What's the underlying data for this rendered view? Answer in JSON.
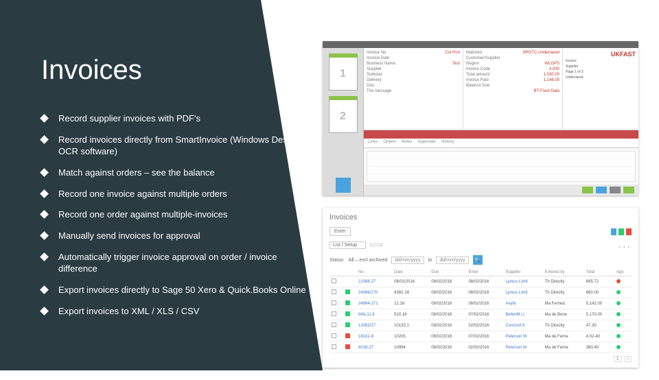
{
  "title": "Invoices",
  "bullets": [
    "Record supplier invoices with PDF's",
    "Record invoices directly from SmartInvoice (Windows Desktop OCR software)",
    "Match against orders – see the balance",
    "Record one invoice against multiple orders",
    "Record one order against multiple-invoices",
    "Manually send invoices for approval",
    "Automatically trigger invoice approval on order / invoice difference",
    "Export invoices directly to Sage 50 Xero & Quick.Books Online",
    "Export invoices to XML / XLS / CSV"
  ],
  "app_shot": {
    "thumbs": [
      "1",
      "2"
    ],
    "logo": "UKFAST",
    "header_form": {
      "col1": [
        {
          "lab": "Invoice No",
          "val": "Col Port"
        },
        {
          "lab": "Invoice Date",
          "val": ""
        },
        {
          "lab": "Business Name",
          "val": "Test"
        },
        {
          "lab": "Supplier",
          "val": ""
        },
        {
          "lab": "Subtotal",
          "val": ""
        },
        {
          "lab": "Delivery",
          "val": ""
        },
        {
          "lab": "Disc",
          "val": ""
        },
        {
          "lab": "The message",
          "val": ""
        }
      ],
      "col2": [
        {
          "lab": "Matched",
          "val": "BRSTC-Undeclared"
        },
        {
          "lab": "Customer/Supplier",
          "val": ""
        },
        {
          "lab": "Region",
          "val": "WLGPS"
        },
        {
          "lab": "Invoice Code",
          "val": "4,930"
        },
        {
          "lab": "Total amount",
          "val": "1,030.00"
        },
        {
          "lab": "Invoice Paid",
          "val": "1,148.00"
        },
        {
          "lab": "Balance Due",
          "val": ""
        },
        {
          "lab": "",
          "val": "BT-Food Data"
        }
      ]
    },
    "side_lines": [
      "Invoice",
      "Supplier",
      "Page 1 of 3",
      "Undeclared"
    ],
    "tabs": [
      "Lines",
      "Orders",
      "Notes",
      "Approvals",
      "History"
    ]
  },
  "web_shot": {
    "title": "Invoices",
    "btn": "Enter",
    "filter_label": "List / Setup",
    "status_prefix": "Status:",
    "status_all": "All – excl archived",
    "to": "to",
    "headers": [
      "",
      "",
      "No",
      "Date",
      "Due",
      "Enter",
      "Supplier",
      "Entered by",
      "Total",
      "App"
    ],
    "rows": [
      {
        "sq": "",
        "no": "21088-27",
        "date": "08/02/2016",
        "due": "08/02/2016",
        "enter": "08/02/2016",
        "supplier": "Lyreco Limit",
        "by": "Th Directly",
        "total": "665.72",
        "app": "red"
      },
      {
        "sq": "green",
        "no": "24086/270",
        "date": "6382-16",
        "due": "08/02/2016",
        "enter": "08/02/2016",
        "supplier": "Lyreco Limit",
        "by": "Th Directly",
        "total": "680.00",
        "app": "green"
      },
      {
        "sq": "green",
        "no": "24994-271",
        "date": "12.16",
        "due": "08/02/2016",
        "enter": "08/02/2016",
        "supplier": "Avylis",
        "by": "Ma Ferned",
        "total": "5,142.00",
        "app": "green"
      },
      {
        "sq": "green",
        "no": "MAL11.8",
        "date": "510.18",
        "due": "08/02/2016",
        "enter": "07/02/2016",
        "supplier": "BetterM Li",
        "by": "Ma de Bone",
        "total": "5,170.00",
        "app": "green"
      },
      {
        "sq": "green",
        "no": "12082/27",
        "date": "10133.1",
        "due": "08/02/2016",
        "enter": "02/02/2016",
        "supplier": "Concord 9",
        "by": "Th Directly",
        "total": "47.30",
        "app": "green"
      },
      {
        "sq": "red",
        "no": "16022-8",
        "date": "10205",
        "due": "06/02/2016",
        "enter": "07/02/2016",
        "supplier": "Peterson M",
        "by": "Ma de Ferne",
        "total": "4.02-40",
        "app": "green"
      },
      {
        "sq": "red",
        "no": "6028-27",
        "date": "10994",
        "due": "06/02/2016",
        "enter": "02/02/2016",
        "supplier": "Peterson M",
        "by": "Ma de Ferne",
        "total": "360.40",
        "app": "green"
      }
    ]
  }
}
